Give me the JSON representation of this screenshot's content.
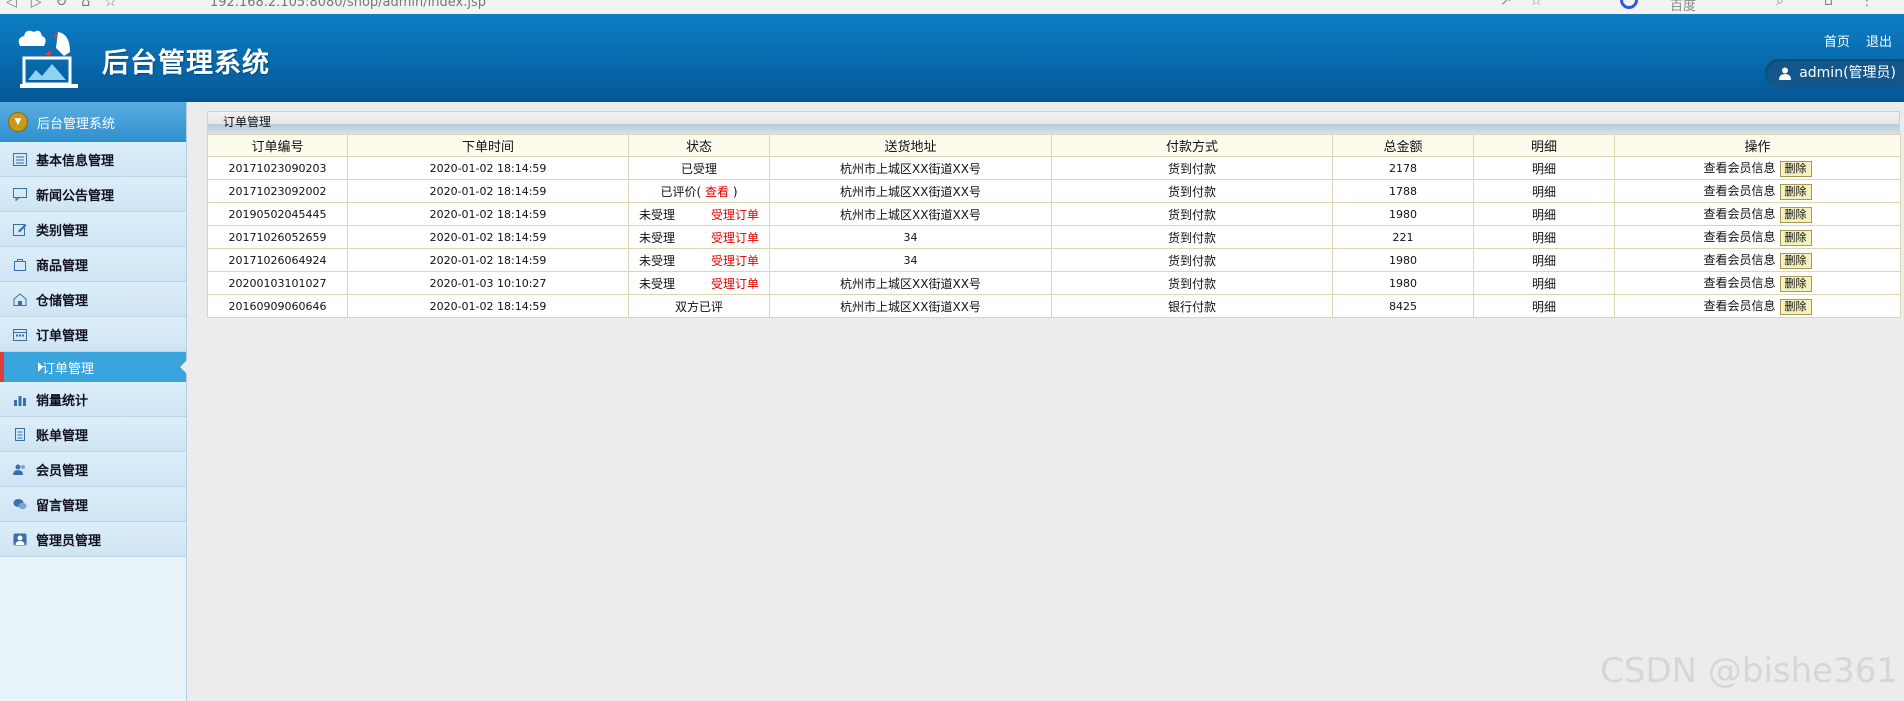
{
  "browser": {
    "url": "192.168.2.105:8080/shop/admin/index.jsp",
    "search_engine": "百度"
  },
  "header": {
    "title": "后台管理系统",
    "links": [
      "首页",
      "退出"
    ],
    "user": "admin(管理员)"
  },
  "sidebar": {
    "head": "后台管理系统",
    "items": [
      "基本信息管理",
      "新闻公告管理",
      "类别管理",
      "商品管理",
      "仓储管理",
      "订单管理"
    ],
    "active_sub": "订单管理",
    "items_after": [
      "销量统计",
      "账单管理",
      "会员管理",
      "留言管理",
      "管理员管理"
    ]
  },
  "panel": {
    "title": "订单管理",
    "columns": [
      "订单编号",
      "下单时间",
      "状态",
      "送货地址",
      "付款方式",
      "总金额",
      "明细",
      "操作"
    ],
    "rows": [
      {
        "id": "20171023090203",
        "time": "2020-01-02 18:14:59",
        "status": "已受理",
        "status_link": "",
        "address": "杭州市上城区XX街道XX号",
        "pay": "货到付款",
        "total": "2178",
        "detail": "明细",
        "op": "查看会员信息",
        "del": "删除"
      },
      {
        "id": "20171023092002",
        "time": "2020-01-02 18:14:59",
        "status": "已评价(",
        "status_link": "查看",
        "status_tail": ")",
        "address": "杭州市上城区XX街道XX号",
        "pay": "货到付款",
        "total": "1788",
        "detail": "明细",
        "op": "查看会员信息",
        "del": "删除"
      },
      {
        "id": "20190502045445",
        "time": "2020-01-02 18:14:59",
        "status": "未受理",
        "status_link": "受理订单",
        "address": "杭州市上城区XX街道XX号",
        "pay": "货到付款",
        "total": "1980",
        "detail": "明细",
        "op": "查看会员信息",
        "del": "删除"
      },
      {
        "id": "20171026052659",
        "time": "2020-01-02 18:14:59",
        "status": "未受理",
        "status_link": "受理订单",
        "address": "34",
        "pay": "货到付款",
        "total": "221",
        "detail": "明细",
        "op": "查看会员信息",
        "del": "删除"
      },
      {
        "id": "20171026064924",
        "time": "2020-01-02 18:14:59",
        "status": "未受理",
        "status_link": "受理订单",
        "address": "34",
        "pay": "货到付款",
        "total": "1980",
        "detail": "明细",
        "op": "查看会员信息",
        "del": "删除"
      },
      {
        "id": "20200103101027",
        "time": "2020-01-03 10:10:27",
        "status": "未受理",
        "status_link": "受理订单",
        "address": "杭州市上城区XX街道XX号",
        "pay": "货到付款",
        "total": "1980",
        "detail": "明细",
        "op": "查看会员信息",
        "del": "删除"
      },
      {
        "id": "20160909060646",
        "time": "2020-01-02 18:14:59",
        "status": "双方已评",
        "status_link": "",
        "address": "杭州市上城区XX街道XX号",
        "pay": "银行付款",
        "total": "8425",
        "detail": "明细",
        "op": "查看会员信息",
        "del": "删除"
      }
    ]
  },
  "watermark": "CSDN @bishe361",
  "colors": {
    "header": "#0869ac",
    "accent_red": "#e00000",
    "active_menu": "#3aa5dc"
  }
}
